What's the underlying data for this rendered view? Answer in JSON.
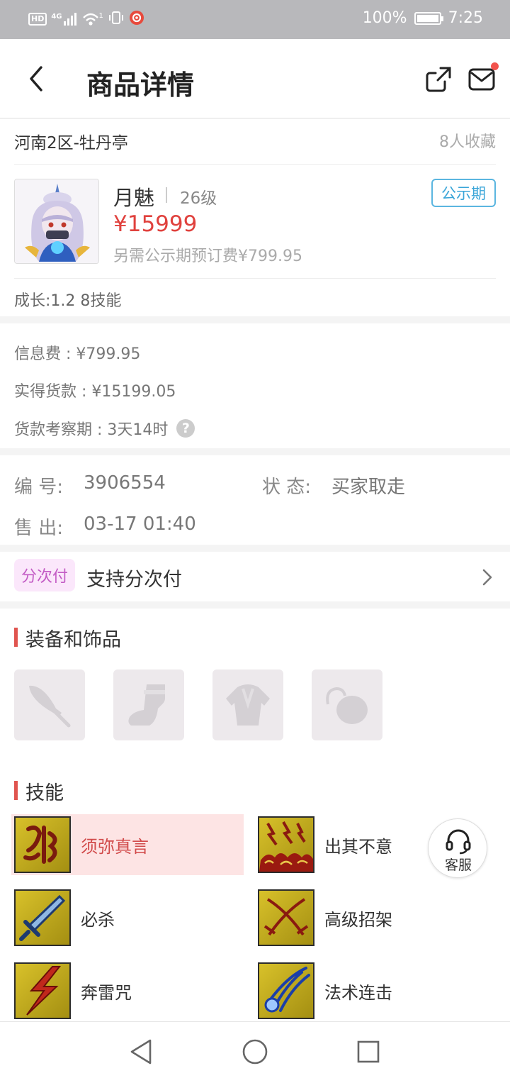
{
  "status_bar": {
    "network_chip": "HD",
    "signal_label": "4G",
    "sim_index": "1",
    "battery": "100%",
    "battery_level": 1.0,
    "time": "7:25",
    "icons": [
      "hd-icon",
      "signal-icon",
      "wifi-icon",
      "vibrate-icon",
      "app-notification-icon",
      "battery-icon"
    ]
  },
  "header": {
    "title": "商品详情",
    "icons": [
      "back-arrow-icon",
      "share-icon",
      "mail-icon"
    ],
    "has_unread_dot": true
  },
  "product": {
    "server": "河南2区-牡丹亭",
    "favorites": "8人收藏",
    "name": "月魅",
    "level": "26级",
    "price": "¥15999",
    "deposit_note": "另需公示期预订费¥799.95",
    "status_tag": "公示期",
    "growth": "成长:1.2 8技能"
  },
  "fees": {
    "info_fee": "信息费 : ¥799.95",
    "actual_payment": "实得货款 : ¥15199.05",
    "review_period": "货款考察期 : 3天14时",
    "help_glyph": "?"
  },
  "order": {
    "id_label": "编  号:",
    "id_value": "3906554",
    "status_label": "状  态:",
    "status_value": "买家取走",
    "sold_label": "售  出:",
    "sold_value": "03-17 01:40"
  },
  "installment": {
    "tag": "分次付",
    "text": "支持分次付"
  },
  "equipment": {
    "title": "装备和饰品",
    "slots": [
      "sword-icon",
      "boot-icon",
      "armor-icon",
      "accessory-icon"
    ]
  },
  "skills": {
    "title": "技能",
    "items": [
      {
        "name": "须弥真言",
        "icon": "rune-skill-icon",
        "active": true
      },
      {
        "name": "出其不意",
        "icon": "lightning-cloud-skill-icon",
        "active": false
      },
      {
        "name": "必杀",
        "icon": "sword-skill-icon",
        "active": false
      },
      {
        "name": "高级招架",
        "icon": "crossed-swords-skill-icon",
        "active": false
      },
      {
        "name": "奔雷咒",
        "icon": "thunder-skill-icon",
        "active": false
      },
      {
        "name": "法术连击",
        "icon": "magic-combo-skill-icon",
        "active": false
      }
    ]
  },
  "customer_service": {
    "label": "客服",
    "icon": "headset-icon"
  },
  "nav": {
    "icons": [
      "nav-back-icon",
      "nav-home-icon",
      "nav-recents-icon"
    ]
  },
  "colors": {
    "accent_red": "#e0413d",
    "tag_blue": "#3aa5d8",
    "installment_purple": "#c35cc5",
    "section_bar": "#e0544f"
  }
}
